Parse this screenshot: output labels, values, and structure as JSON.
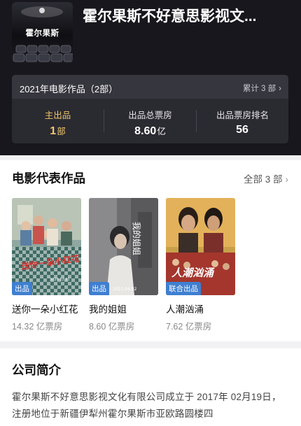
{
  "company": {
    "title": "霍尔果斯不好意思影视文...",
    "logo_text": "霍尔果斯"
  },
  "stats": {
    "year_label": "2021年电影作品（2部）",
    "total_label": "累计 3 部",
    "chevron": "›",
    "columns": [
      {
        "label": "主出品",
        "value": "1",
        "unit": "部"
      },
      {
        "label": "出品总票房",
        "value": "8.60",
        "unit": "亿"
      },
      {
        "label": "出品票房排名",
        "value": "56",
        "unit": ""
      }
    ]
  },
  "works": {
    "title": "电影代表作品",
    "more_label": "全部 3 部",
    "chevron": "›",
    "films": [
      {
        "name": "送你一朵小红花",
        "box_office": "14.32 亿票房",
        "badge": "出品",
        "poster_title": "送你一朵小红花",
        "poster_date": "2020.12.31",
        "icon": "poster-family-table"
      },
      {
        "name": "我的姐姐",
        "box_office": "8.60 亿票房",
        "badge": "出品",
        "poster_title": "我的姐姐",
        "poster_date": "2021.04.02",
        "icon": "poster-girl-portrait"
      },
      {
        "name": "人潮汹涌",
        "box_office": "7.62 亿票房",
        "badge": "联合出品",
        "poster_title": "人潮汹涌",
        "icon": "poster-action-crowd"
      }
    ]
  },
  "intro": {
    "title": "公司简介",
    "body": "霍尔果斯不好意思影视文化有限公司成立于 2017年 02月19日，注册地位于新疆伊犁州霍尔果斯市亚欧路圆楼四"
  },
  "colors": {
    "header_bg": "#17171d",
    "card_bg": "#2a2a31",
    "highlight": "#f2c86d",
    "badge_blue": "#3f7fd1"
  }
}
